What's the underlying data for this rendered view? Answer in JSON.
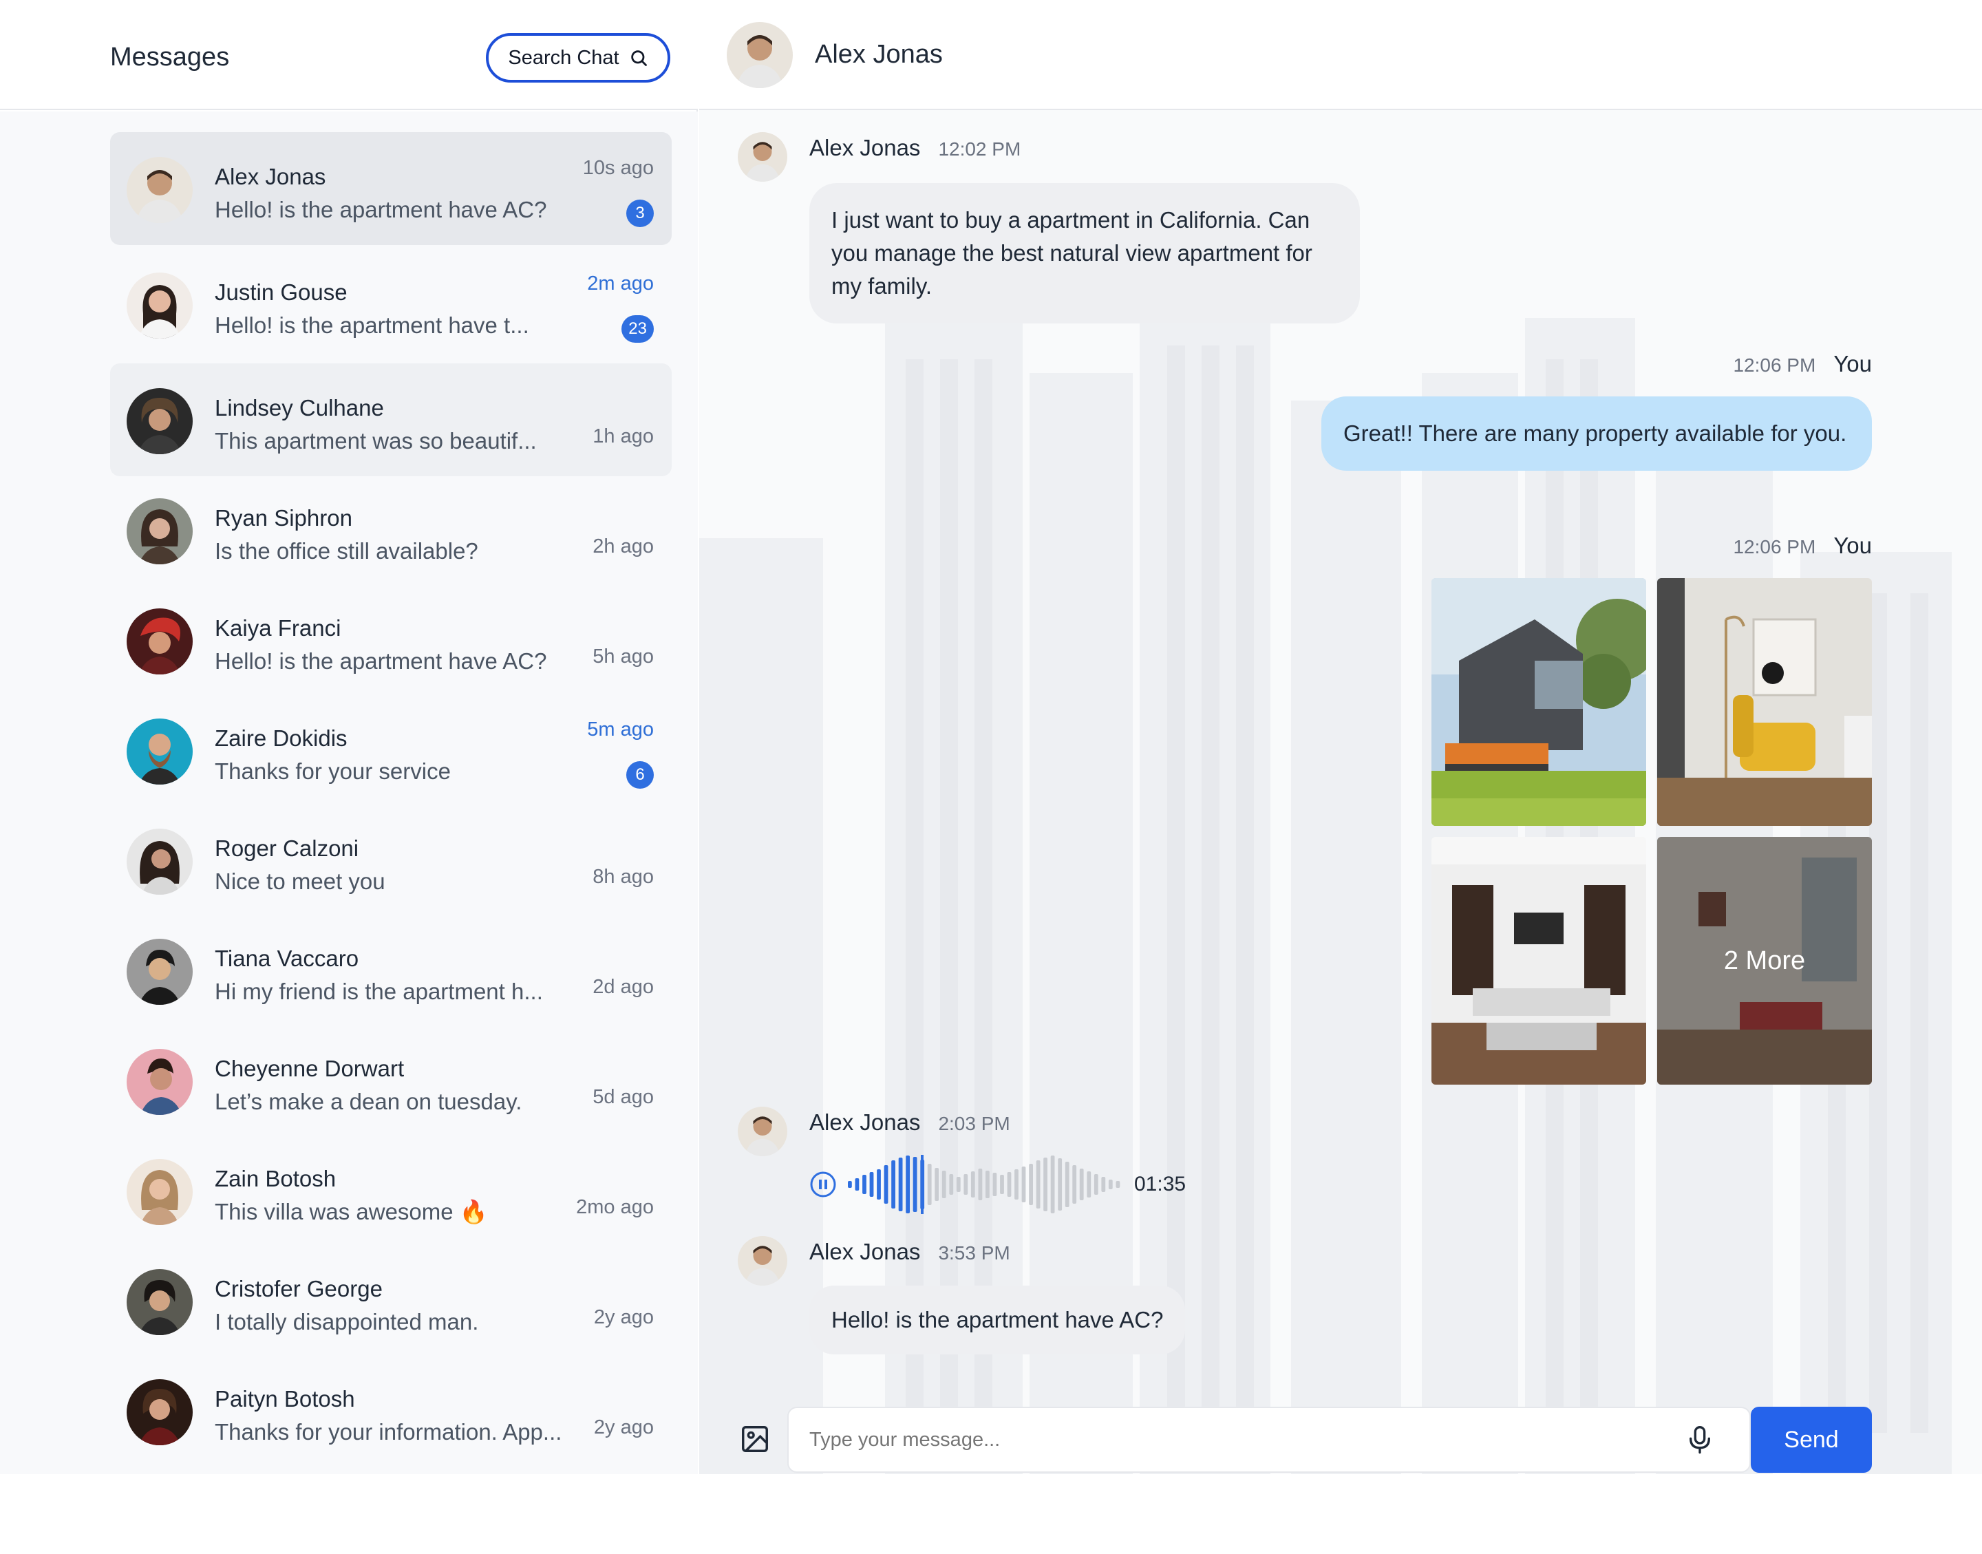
{
  "sidebar": {
    "title": "Messages",
    "search_label": "Search Chat",
    "conversations": [
      {
        "name": "Alex Jonas",
        "preview": "Hello! is the apartment have AC?",
        "time": "10s ago",
        "badge": "3"
      },
      {
        "name": "Justin Gouse",
        "preview": "Hello! is the apartment have t...",
        "time": "2m ago",
        "badge": "23"
      },
      {
        "name": "Lindsey Culhane",
        "preview": "This apartment was so beautif...",
        "time": "1h ago",
        "badge": ""
      },
      {
        "name": "Ryan Siphron",
        "preview": "Is the office still available?",
        "time": "2h ago",
        "badge": ""
      },
      {
        "name": "Kaiya Franci",
        "preview": "Hello! is the apartment have AC?",
        "time": "5h ago",
        "badge": ""
      },
      {
        "name": "Zaire Dokidis",
        "preview": "Thanks for your service",
        "time": "5m ago",
        "badge": "6"
      },
      {
        "name": "Roger Calzoni",
        "preview": "Nice to meet you",
        "time": "8h ago",
        "badge": ""
      },
      {
        "name": "Tiana Vaccaro",
        "preview": "Hi my friend is the apartment h...",
        "time": "2d ago",
        "badge": ""
      },
      {
        "name": "Cheyenne Dorwart",
        "preview": "Let’s make a dean on tuesday.",
        "time": "5d ago",
        "badge": ""
      },
      {
        "name": "Zain Botosh",
        "preview": "This villa was awesome 🔥",
        "time": "2mo ago",
        "badge": ""
      },
      {
        "name": "Cristofer George",
        "preview": "I totally disappointed man.",
        "time": "2y ago",
        "badge": ""
      },
      {
        "name": "Paityn Botosh",
        "preview": "Thanks for your information. App...",
        "time": "2y ago",
        "badge": ""
      }
    ]
  },
  "chat": {
    "contact_name": "Alex Jonas",
    "messages": [
      {
        "sender": "Alex Jonas",
        "time": "12:02 PM",
        "text": "I just want to buy a apartment in California. Can you manage the best natural view apartment for my family."
      },
      {
        "sender": "You",
        "time": "12:06 PM",
        "text": "Great!! There are many property available for you."
      },
      {
        "sender": "You",
        "time": "12:06 PM",
        "more_label": "2 More"
      },
      {
        "sender": "Alex Jonas",
        "time": "2:03 PM",
        "voice_duration": "01:35",
        "voice_progress": 0.27
      },
      {
        "sender": "Alex Jonas",
        "time": "3:53 PM",
        "text": "Hello! is the apartment have AC?"
      }
    ]
  },
  "composer": {
    "placeholder": "Type your message...",
    "send_label": "Send"
  },
  "colors": {
    "accent": "#2563eb",
    "badge": "#2f6fe0",
    "outgoing_bubble": "#bfe2fb",
    "incoming_bubble": "#eeeff2"
  }
}
